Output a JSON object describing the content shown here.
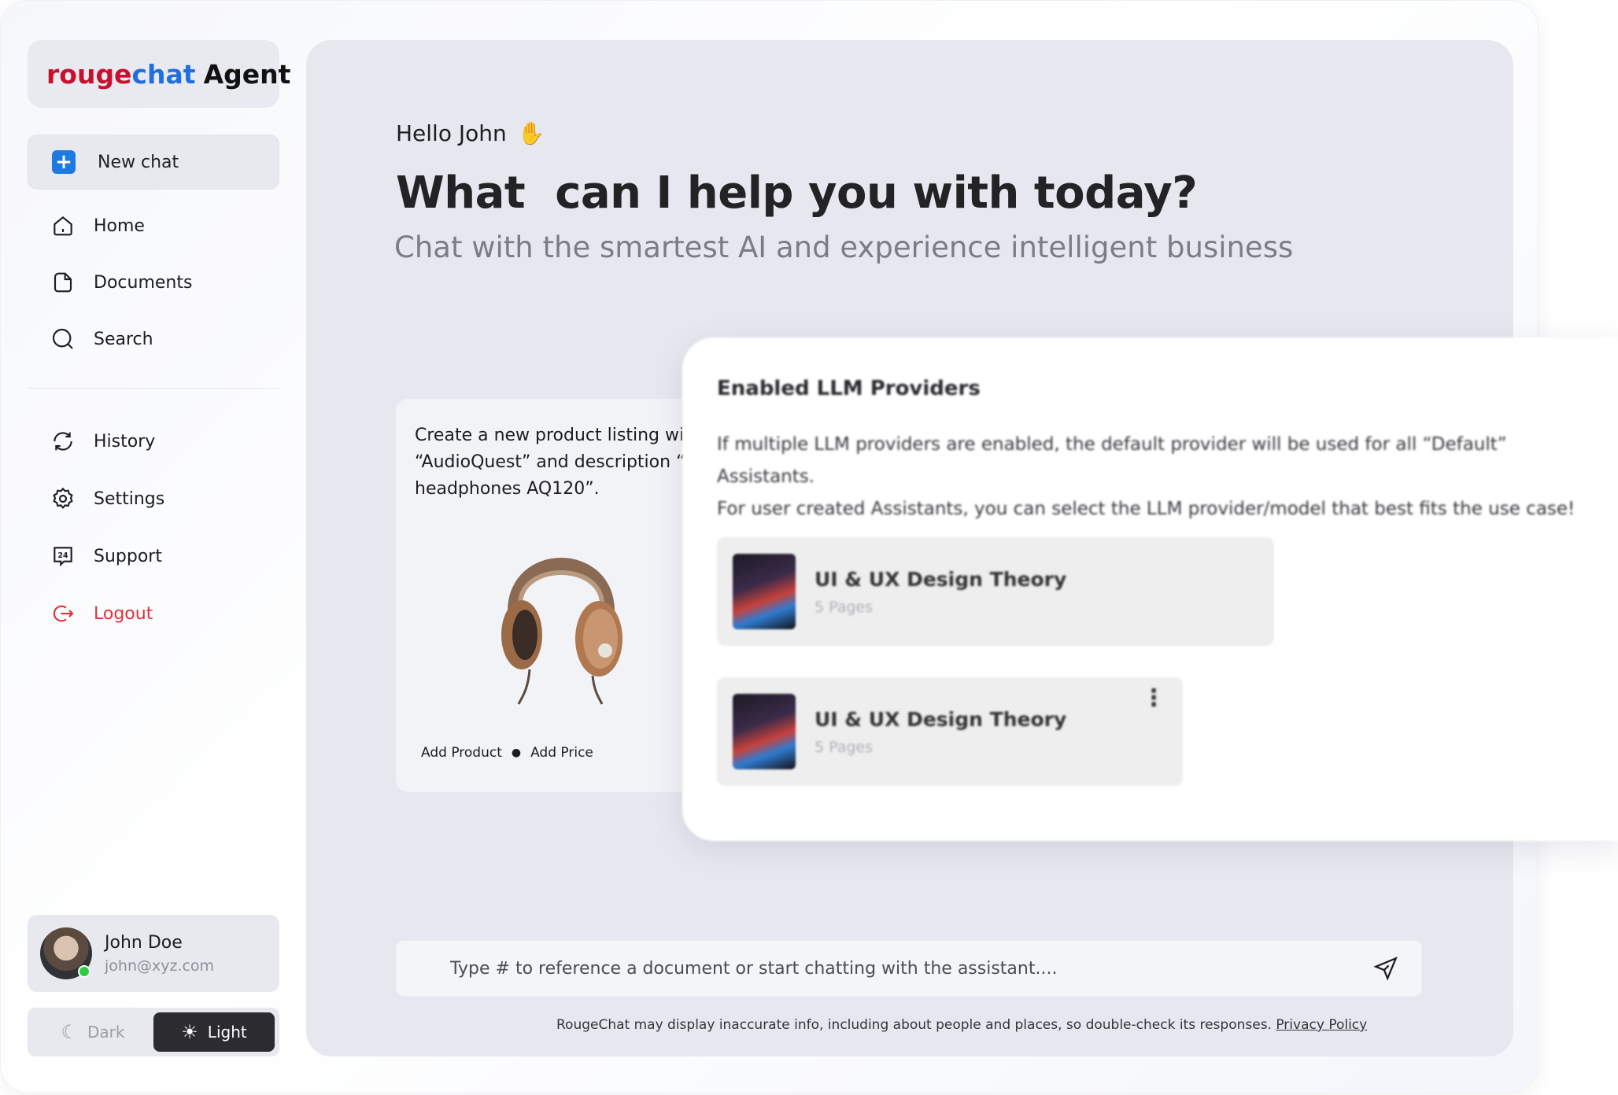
{
  "brand": {
    "logo_part1": "rouge",
    "logo_part2": "chat",
    "logo_part3": "Agent"
  },
  "sidebar": {
    "new_chat": "New chat",
    "items": [
      {
        "label": "Home",
        "icon": "home-icon"
      },
      {
        "label": "Documents",
        "icon": "document-icon"
      },
      {
        "label": "Search",
        "icon": "search-icon"
      },
      {
        "label": "History",
        "icon": "history-icon"
      },
      {
        "label": "Settings",
        "icon": "gear-icon"
      },
      {
        "label": "Support",
        "icon": "support-24-icon"
      },
      {
        "label": "Logout",
        "icon": "logout-icon"
      }
    ],
    "user": {
      "name": "John Doe",
      "email": "john@xyz.com",
      "status": "online"
    },
    "theme": {
      "dark_label": "Dark",
      "light_label": "Light",
      "selected": "Light"
    }
  },
  "main": {
    "greeting": "Hello John",
    "greeting_emoji": "✋",
    "headline": "What  can I help you with today?",
    "subheadline": "Chat with the smartest AI and experience intelligent business",
    "prompt_card": {
      "text": "Create a new product listing with name “AudioQuest” and description “Hurricane headphones AQ120”.",
      "image": "headphones",
      "action_1": "Add Product",
      "action_2": "Add Price"
    },
    "llm_panel": {
      "title": "Enabled LLM Providers",
      "description_line1": "If multiple LLM providers are enabled, the default provider will be used for all “Default” Assistants.",
      "description_line2": "For user created Assistants, you can select the LLM provider/model that best fits the use case!",
      "documents": [
        {
          "title": "UI & UX Design Theory",
          "meta": "5 Pages"
        },
        {
          "title": "UI & UX Design Theory",
          "meta": "5 Pages"
        }
      ]
    },
    "chat_input": {
      "placeholder": "Type # to reference a document or start chatting with the assistant...."
    },
    "disclaimer": "RougeChat may display inaccurate info, including about people and places, so double-check its responses.",
    "privacy_link": "Privacy Policy"
  },
  "colors": {
    "accent": "#1f7ae0",
    "logout": "#e0303a",
    "brand_red": "#c8102e",
    "brand_blue": "#1f6fe0",
    "online": "#2ecc40"
  }
}
